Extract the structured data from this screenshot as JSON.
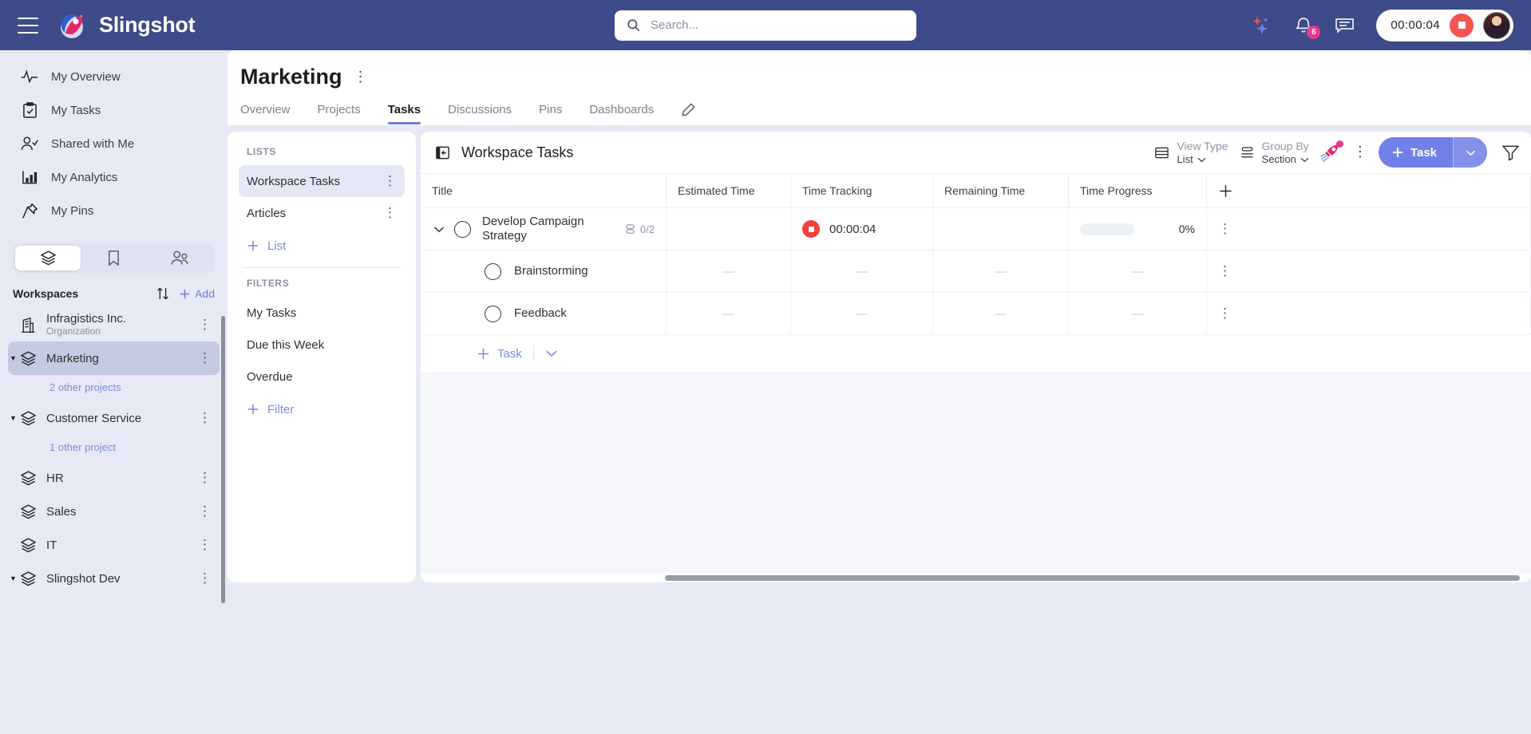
{
  "topbar": {
    "menu_icon": "hamburger-icon",
    "brand": "Slingshot",
    "search_placeholder": "Search...",
    "ai_icon": "sparkle-icon",
    "notifications_badge": "6",
    "chat_icon": "chat-icon",
    "timer_value": "00:00:04",
    "stop_label": "stop-icon"
  },
  "sidebar": {
    "nav": [
      {
        "label": "My Overview",
        "icon": "activity-icon"
      },
      {
        "label": "My Tasks",
        "icon": "clipboard-check-icon"
      },
      {
        "label": "Shared with Me",
        "icon": "user-check-icon"
      },
      {
        "label": "My Analytics",
        "icon": "bar-chart-icon"
      },
      {
        "label": "My Pins",
        "icon": "pin-icon"
      }
    ],
    "segments": [
      {
        "name": "workspaces",
        "icon": "layers-icon",
        "active": true
      },
      {
        "name": "bookmarks",
        "icon": "bookmark-icon",
        "active": false
      },
      {
        "name": "people",
        "icon": "people-icon",
        "active": false
      }
    ],
    "workspaces_title": "Workspaces",
    "sort_icon": "sort-arrows-icon",
    "add_label": "Add",
    "items": [
      {
        "label": "Infragistics Inc.",
        "sub": "Organization",
        "icon": "building-icon",
        "selected": false,
        "expandable": false
      },
      {
        "label": "Marketing",
        "sub": "",
        "icon": "layers-icon",
        "selected": true,
        "expandable": true
      },
      {
        "label": "Customer Service",
        "sub": "",
        "icon": "layers-icon",
        "selected": false,
        "expandable": true
      },
      {
        "label": "HR",
        "sub": "",
        "icon": "layers-icon",
        "selected": false,
        "expandable": false
      },
      {
        "label": "Sales",
        "sub": "",
        "icon": "layers-icon",
        "selected": false,
        "expandable": false
      },
      {
        "label": "IT",
        "sub": "",
        "icon": "layers-icon",
        "selected": false,
        "expandable": false
      },
      {
        "label": "Slingshot Dev",
        "sub": "",
        "icon": "layers-icon",
        "selected": false,
        "expandable": true
      }
    ],
    "marketing_other_projects": "2 other projects",
    "customer_service_other_projects": "1 other project"
  },
  "page": {
    "title": "Marketing",
    "tabs": [
      {
        "label": "Overview",
        "active": false
      },
      {
        "label": "Projects",
        "active": false
      },
      {
        "label": "Tasks",
        "active": true
      },
      {
        "label": "Discussions",
        "active": false
      },
      {
        "label": "Pins",
        "active": false
      },
      {
        "label": "Dashboards",
        "active": false
      }
    ],
    "edit_icon": "pencil-icon"
  },
  "lists_panel": {
    "lists_header": "LISTS",
    "lists": [
      {
        "label": "Workspace Tasks",
        "active": true
      },
      {
        "label": "Articles",
        "active": false
      }
    ],
    "add_list": "List",
    "filters_header": "FILTERS",
    "filters": [
      {
        "label": "My Tasks"
      },
      {
        "label": "Due this Week"
      },
      {
        "label": "Overdue"
      }
    ],
    "add_filter": "Filter"
  },
  "tasks_panel": {
    "collapse_icon": "panel-collapse-icon",
    "title": "Workspace Tasks",
    "view_type": {
      "label": "View Type",
      "value": "List",
      "icon": "list-view-icon"
    },
    "group_by": {
      "label": "Group By",
      "value": "Section",
      "icon": "group-by-icon"
    },
    "rocket_icon": "rocket-icon",
    "more_icon": "kebab-icon",
    "add_task_label": "Task",
    "filter_icon": "funnel-icon",
    "columns": [
      "Title",
      "Estimated Time",
      "Time Tracking",
      "Remaining Time",
      "Time Progress"
    ],
    "add_column_icon": "plus-icon",
    "rows": [
      {
        "title": "Develop Campaign Strategy",
        "subtask_count": "0/2",
        "estimated_time": "",
        "time_tracking": "00:00:04",
        "tracking_active": true,
        "remaining_time": "",
        "time_progress": "0%",
        "progress_value": 0,
        "is_parent": true
      },
      {
        "title": "Brainstorming",
        "subtask_count": "",
        "estimated_time": "—",
        "time_tracking": "—",
        "tracking_active": false,
        "remaining_time": "—",
        "time_progress": "—",
        "progress_value": 0,
        "is_parent": false
      },
      {
        "title": "Feedback",
        "subtask_count": "",
        "estimated_time": "—",
        "time_tracking": "—",
        "tracking_active": false,
        "remaining_time": "—",
        "time_progress": "—",
        "progress_value": 0,
        "is_parent": false
      }
    ],
    "footer_add_task": "Task"
  },
  "colors": {
    "brand_navy": "#3f4a8a",
    "accent_blue": "#7180e8",
    "link_blue": "#7b8ae0",
    "badge_pink": "#e6398c",
    "record_red": "#f2403c",
    "sidebar_bg": "#e7eaf4"
  }
}
